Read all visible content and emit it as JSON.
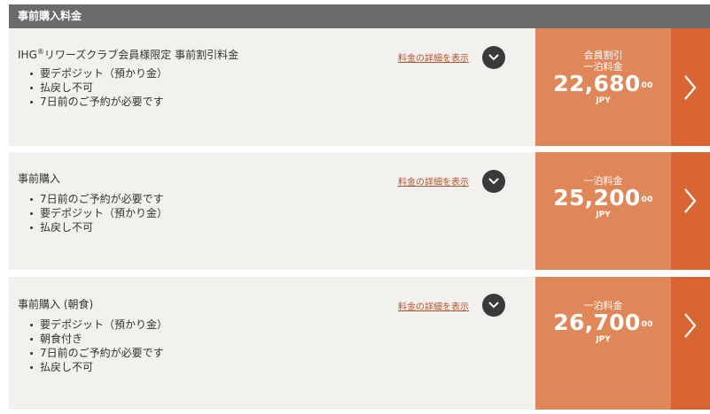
{
  "header": {
    "title": "事前購入料金"
  },
  "details_link_label": "料金の詳細を表示",
  "rates": [
    {
      "name_prefix": "IHG",
      "name_sup": "®",
      "name_suffix": "リワーズクラブ会員様限定 事前割引料金",
      "bullets": [
        "要デポジット（預かり金）",
        "払戻し不可",
        "7日前のご予約が必要です"
      ],
      "price_labels": [
        "会員割引",
        "一泊料金"
      ],
      "price": "22,680",
      "cents": "00",
      "currency": "JPY"
    },
    {
      "name_prefix": "事前購入",
      "name_sup": "",
      "name_suffix": "",
      "bullets": [
        "7日前のご予約が必要です",
        "要デポジット（預かり金）",
        "払戻し不可"
      ],
      "price_labels": [
        "一泊料金"
      ],
      "price": "25,200",
      "cents": "00",
      "currency": "JPY"
    },
    {
      "name_prefix": "事前購入 (朝食)",
      "name_sup": "",
      "name_suffix": "",
      "bullets": [
        "要デポジット（預かり金）",
        "朝食付き",
        "7日前のご予約が必要です",
        "払戻し不可"
      ],
      "price_labels": [
        "一泊料金"
      ],
      "price": "26,700",
      "cents": "00",
      "currency": "JPY"
    }
  ],
  "icons": {
    "expand": "chevron-down-icon",
    "select": "chevron-right-icon"
  },
  "colors": {
    "header_bg": "#6b6b6b",
    "card_bg": "#f2f1ed",
    "price_bg": "#e0875a",
    "select_bg": "#d96632",
    "link": "#b4532a"
  }
}
